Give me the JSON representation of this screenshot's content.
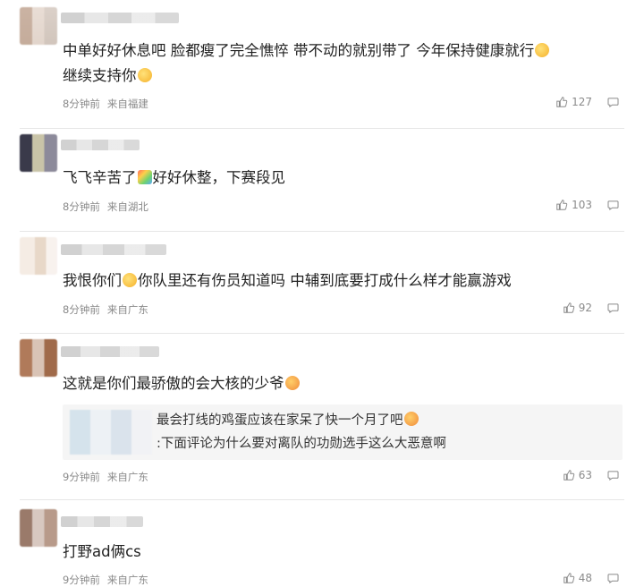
{
  "comments": [
    {
      "text": "中单好好休息吧 脸都瘦了完全憔悴 带不动的就别带了 今年保持健康就行",
      "text2": "继续支持你",
      "time": "8分钟前",
      "location": "来自福建",
      "likes": "127"
    },
    {
      "text": "飞飞辛苦了",
      "text_after": "好好休整，下赛段见",
      "time": "8分钟前",
      "location": "来自湖北",
      "likes": "103"
    },
    {
      "text": "我恨你们",
      "text_after": "你队里还有伤员知道吗 中辅到底要打成什么样才能赢游戏",
      "time": "8分钟前",
      "location": "来自广东",
      "likes": "92"
    },
    {
      "text": "这就是你们最骄傲的会大核的少爷",
      "quote_line1": "最会打线的鸡蛋应该在家呆了快一个月了吧",
      "quote_line2": ":下面评论为什么要对离队的功勋选手这么大恶意啊",
      "time": "9分钟前",
      "location": "来自广东",
      "likes": "63"
    },
    {
      "text": "打野ad俩cs",
      "time": "9分钟前",
      "location": "来自广东",
      "likes": "48"
    }
  ],
  "icons": {
    "like": "thumbs-up-icon",
    "reply": "comment-bubble-icon"
  },
  "colors": {
    "meta": "#8a8a8a",
    "quote_bg": "#f5f5f5"
  }
}
